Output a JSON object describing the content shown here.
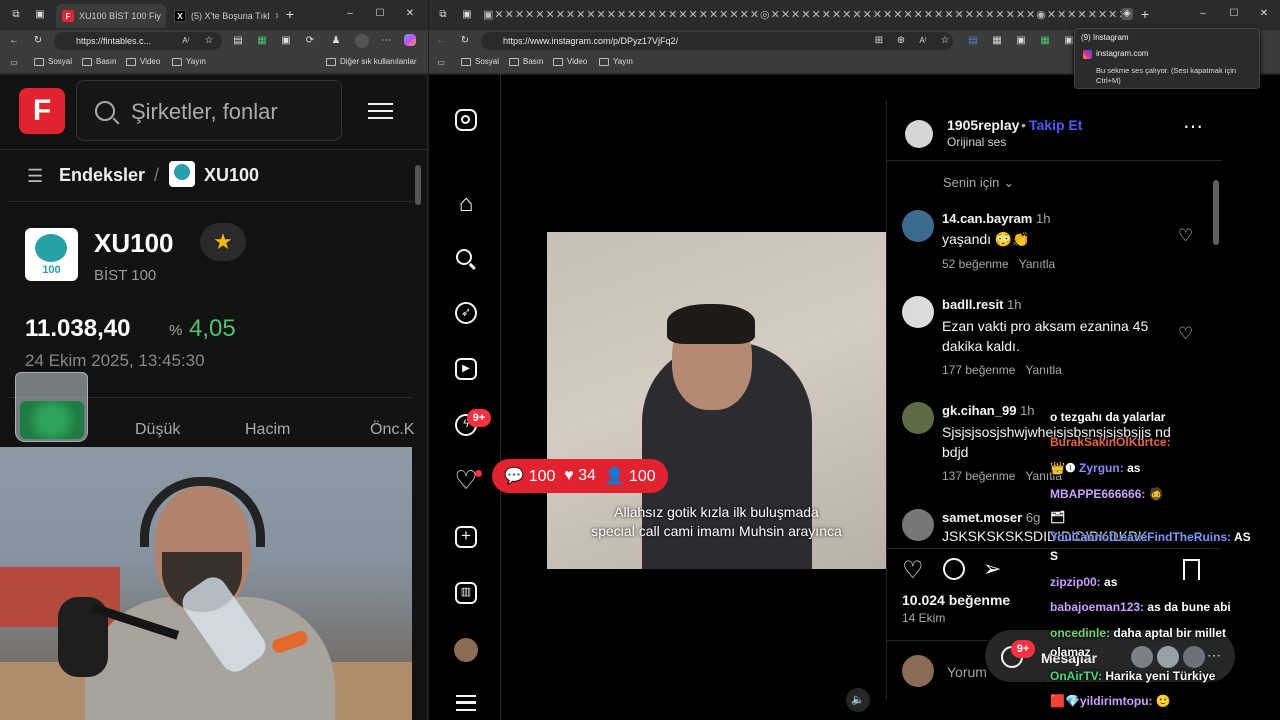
{
  "left_browser": {
    "tabs": [
      {
        "label": "XU100 BİST 100 Fiy",
        "active": true
      },
      {
        "label": "(5) X'te Boşuna Tıkl",
        "active": false
      }
    ],
    "url": "https://fintables.c...",
    "bookmarks": [
      "Sosyal",
      "Basın",
      "Video",
      "Yayın"
    ],
    "other_bookmarks": "Diğer sık kullanılanlar"
  },
  "right_browser": {
    "url": "https://www.instagram.com/p/DPyz17VjFq2/",
    "bookmarks": [
      "Sosyal",
      "Basın",
      "Video",
      "Yayın"
    ],
    "tooltip": {
      "title": "(9) Instagram",
      "site": "instagram.com",
      "note": "Bu sekme ses çalıyor. (Sesi kapatmak için Ctrl+M)"
    }
  },
  "fintables": {
    "logo_letter": "F",
    "search_placeholder": "Şirketler, fonlar",
    "breadcrumb_root": "Endeksler",
    "breadcrumb_sep": "/",
    "breadcrumb_current": "XU100",
    "index_logo_text": "100",
    "symbol": "XU100",
    "name": "BİST 100",
    "price": "11.038,40",
    "pct_symbol": "%",
    "change": "4,05",
    "datetime": "24 Ekim 2025, 13:45:30",
    "stats_labels": [
      "Düşük",
      "Hacim",
      "Önc.K"
    ]
  },
  "instagram": {
    "username": "1905replay",
    "follow": "Takip Et",
    "audio": "Orijinal ses",
    "sort": "Senin için",
    "comments": [
      {
        "user": "14.can.bayram",
        "time": "1h",
        "text": "yaşandı 😳👏",
        "likes": "52 beğenme",
        "reply": "Yanıtla"
      },
      {
        "user": "badll.resit",
        "time": "1h",
        "text": "Ezan vakti pro aksam ezanina 45 dakika kaldı.",
        "likes": "177 beğenme",
        "reply": "Yanıtla"
      },
      {
        "user": "gk.cihan_99",
        "time": "1h",
        "text": "Sjsjsjsosjshwjwhejsjsbsnsjsjsbsjjs ndbdjd",
        "likes": "137 beğenme",
        "reply": "Yanıtla"
      },
      {
        "user": "samet.moser",
        "time": "6g",
        "text": "JSKSKSKSKSDIDIDIDIDKDKDK",
        "likes": "",
        "reply": ""
      }
    ],
    "like_count": "10.024 beğenme",
    "date": "14 Ekim",
    "comment_placeholder": "Yorum",
    "messages_label": "Mesajlar",
    "messages_badge": "9+",
    "nav_badge": "9+",
    "video_caption_line1": "Allahsız gotik kızla ilk buluşmada",
    "video_caption_line2": "special call cami imamı Muhsin arayınca"
  },
  "stream_overlay": {
    "viewers": "100",
    "hearts": "34",
    "followers": "100",
    "chat": [
      {
        "user": "",
        "text": "o tezgahı da yalarlar"
      },
      {
        "user": "BurakSakinOlKurtce:",
        "text": ""
      },
      {
        "user": "Zyrgun:",
        "text": "as"
      },
      {
        "user": "MBAPPE666666:",
        "text": ""
      },
      {
        "user": "YouCannotLeaveFindTheRuins:",
        "text": "AS"
      },
      {
        "user": "",
        "text": "S"
      },
      {
        "user": "zipzip00:",
        "text": "as"
      },
      {
        "user": "babajoeman123:",
        "text": "as da bune abi"
      },
      {
        "user": "oncedinle:",
        "text": "daha aptal bir millet"
      },
      {
        "user": "",
        "text": "olamaz"
      },
      {
        "user": "OnAirTV:",
        "text": "Harika yeni Türkiye"
      },
      {
        "user": "yildirimtopu:",
        "text": ""
      }
    ]
  },
  "colors": {
    "accent_red": "#e0232e",
    "green": "#4cc36c",
    "ig_blue": "#4a5df9",
    "badge_red": "#ff3040"
  }
}
